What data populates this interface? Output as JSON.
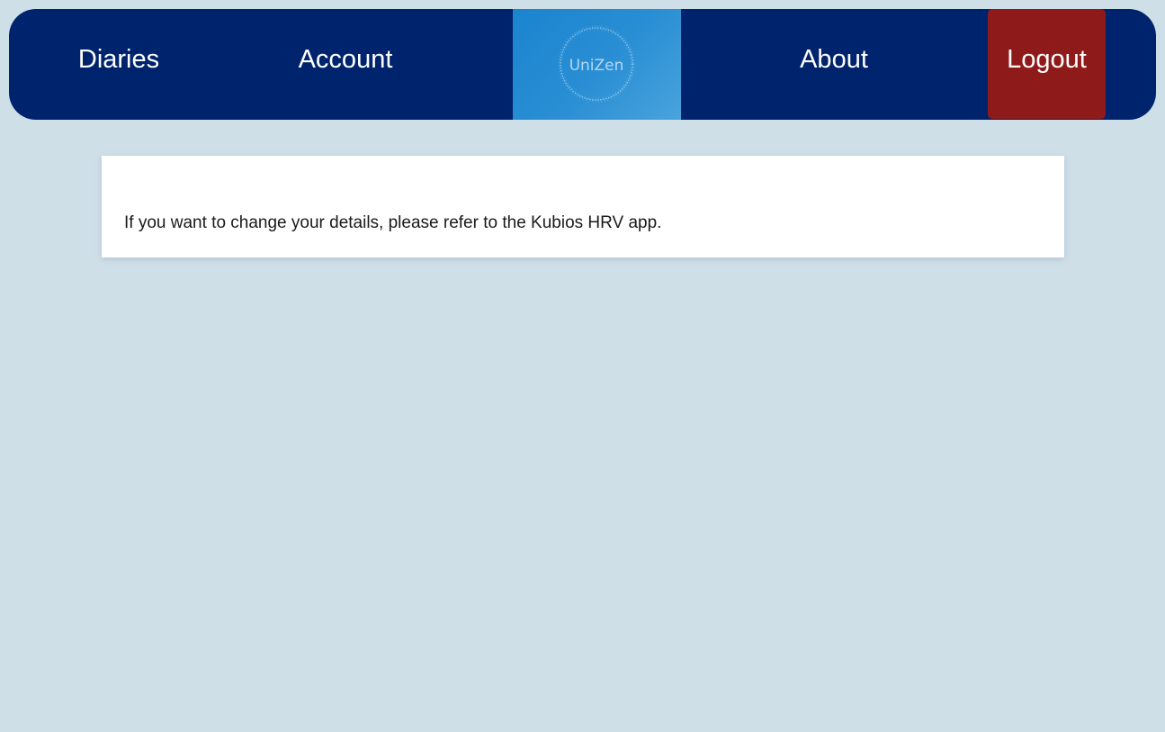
{
  "nav": {
    "diaries": "Diaries",
    "account": "Account",
    "about": "About",
    "logout": "Logout",
    "logo_text": "UniZen"
  },
  "main": {
    "message": "If you want to change your details, please refer to the Kubios HRV app."
  },
  "colors": {
    "navbar": "#00236d",
    "logout": "#8f1a1a",
    "page_background": "#cfdfe8",
    "logo_background": "#2a8fd4"
  }
}
